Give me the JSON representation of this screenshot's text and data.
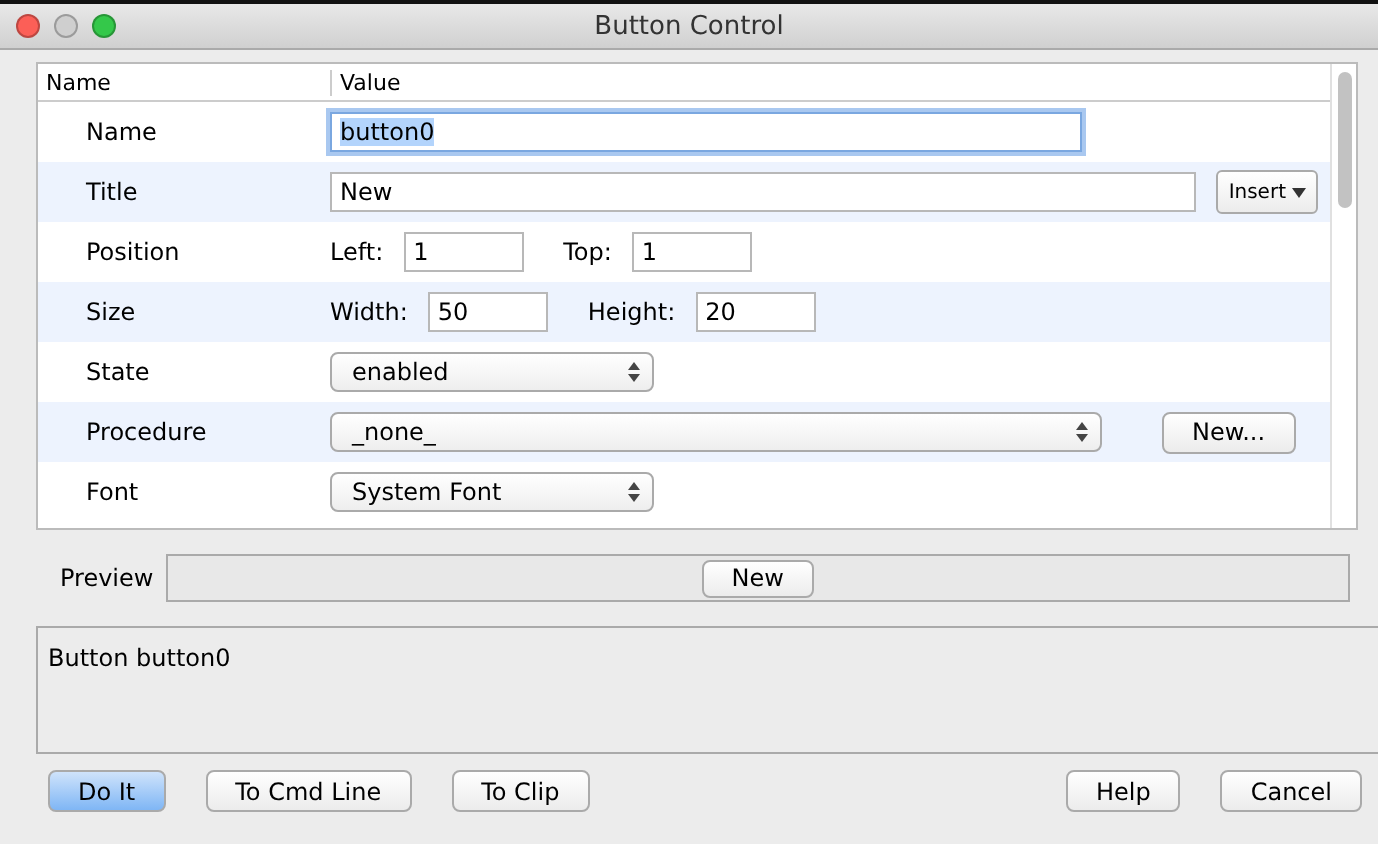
{
  "window": {
    "title": "Button Control"
  },
  "table": {
    "columns": [
      "Name",
      "Value"
    ],
    "rows": [
      {
        "kind": "text",
        "label": "Name",
        "value": "button0",
        "focused": true
      },
      {
        "kind": "text-insert",
        "label": "Title",
        "value": "New",
        "focused": false,
        "button": "Insert"
      },
      {
        "kind": "pair",
        "label": "Position",
        "fields": [
          {
            "label": "Left:",
            "value": "1"
          },
          {
            "label": "Top:",
            "value": "1"
          }
        ]
      },
      {
        "kind": "pair",
        "label": "Size",
        "fields": [
          {
            "label": "Width:",
            "value": "50"
          },
          {
            "label": "Height:",
            "value": "20"
          }
        ]
      },
      {
        "kind": "popup",
        "label": "State",
        "value": "enabled",
        "wide": false
      },
      {
        "kind": "popup-button",
        "label": "Procedure",
        "value": "_none_",
        "wide": true,
        "button": "New..."
      },
      {
        "kind": "popup",
        "label": "Font",
        "value": "System Font",
        "wide": false
      }
    ]
  },
  "preview": {
    "label": "Preview",
    "button": "New"
  },
  "command_text": "Button button0",
  "left_buttons": [
    {
      "label": "Do It",
      "default": true
    },
    {
      "label": "To Cmd Line",
      "default": false
    },
    {
      "label": "To Clip",
      "default": false
    }
  ],
  "right_buttons": [
    {
      "label": "Help",
      "default": false
    },
    {
      "label": "Cancel",
      "default": false
    }
  ]
}
